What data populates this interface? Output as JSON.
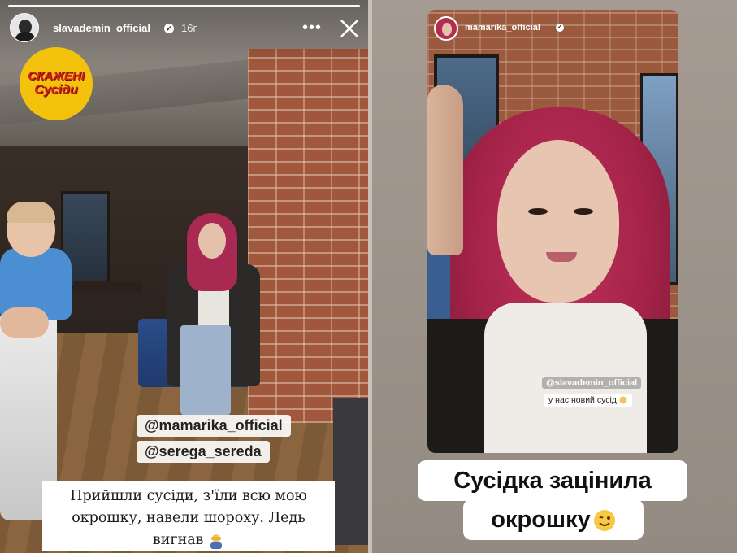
{
  "left_story": {
    "username": "slavademin_official",
    "time": "16г",
    "sticker": {
      "line1": "СКАЖЕНІ",
      "line2": "Сусіди"
    },
    "mentions": [
      "@mamarika_official",
      "@serega_sereda"
    ],
    "caption": {
      "line1": "Прийшли сусіди, з'їли всю мою",
      "line2": "окрошку, навели шороху. Ледь",
      "line3": "вигнав"
    }
  },
  "right_story": {
    "username": "mamarika_official",
    "mention": "@slavademin_official",
    "inner_caption": "у нас новий сусід",
    "big_caption": {
      "line1": "Сусідка зацінила",
      "line2": "окрошку"
    }
  },
  "icons": {
    "verified": "verified-badge-icon",
    "more": "more-options-icon",
    "close": "close-icon",
    "emoji_man": "man-facepalm-emoji",
    "emoji_wink": "winking-face-emoji"
  },
  "colors": {
    "text_white": "#ffffff",
    "sticker_yellow": "#f2c20d",
    "sticker_red": "#d61d1d",
    "hair_magenta": "#a82a52"
  }
}
